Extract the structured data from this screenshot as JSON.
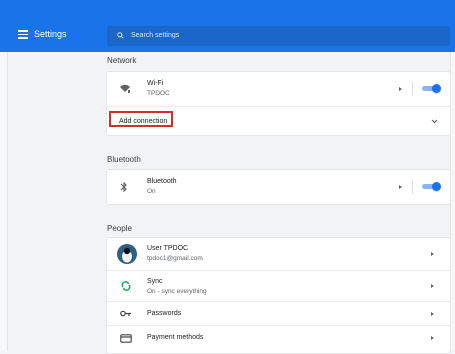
{
  "header": {
    "title": "Settings",
    "search_placeholder": "Search settings"
  },
  "sections": {
    "network": {
      "title": "Network",
      "wifi": {
        "label": "Wi-Fi",
        "status": "TPDOC",
        "enabled": true
      },
      "add_connection": "Add connection"
    },
    "bluetooth": {
      "title": "Bluetooth",
      "item": {
        "label": "Bluetooth",
        "status": "On",
        "enabled": true
      }
    },
    "people": {
      "title": "People",
      "user": {
        "name": "User TPDOC",
        "email": "tpdoc1@gmail.com"
      },
      "sync": {
        "label": "Sync",
        "status": "On - sync everything"
      },
      "passwords": "Passwords",
      "payment_methods": "Payment methods"
    }
  },
  "colors": {
    "accent": "#1a73e8",
    "highlight": "#d32f2f",
    "sync_icon": "#0f9d58"
  },
  "icons": {
    "menu": "hamburger-menu-icon",
    "search": "search-icon",
    "wifi": "wifi-icon",
    "bluetooth": "bluetooth-icon",
    "avatar": "user-avatar-icon",
    "sync": "sync-icon",
    "passwords": "key-icon",
    "payment": "credit-card-icon"
  }
}
